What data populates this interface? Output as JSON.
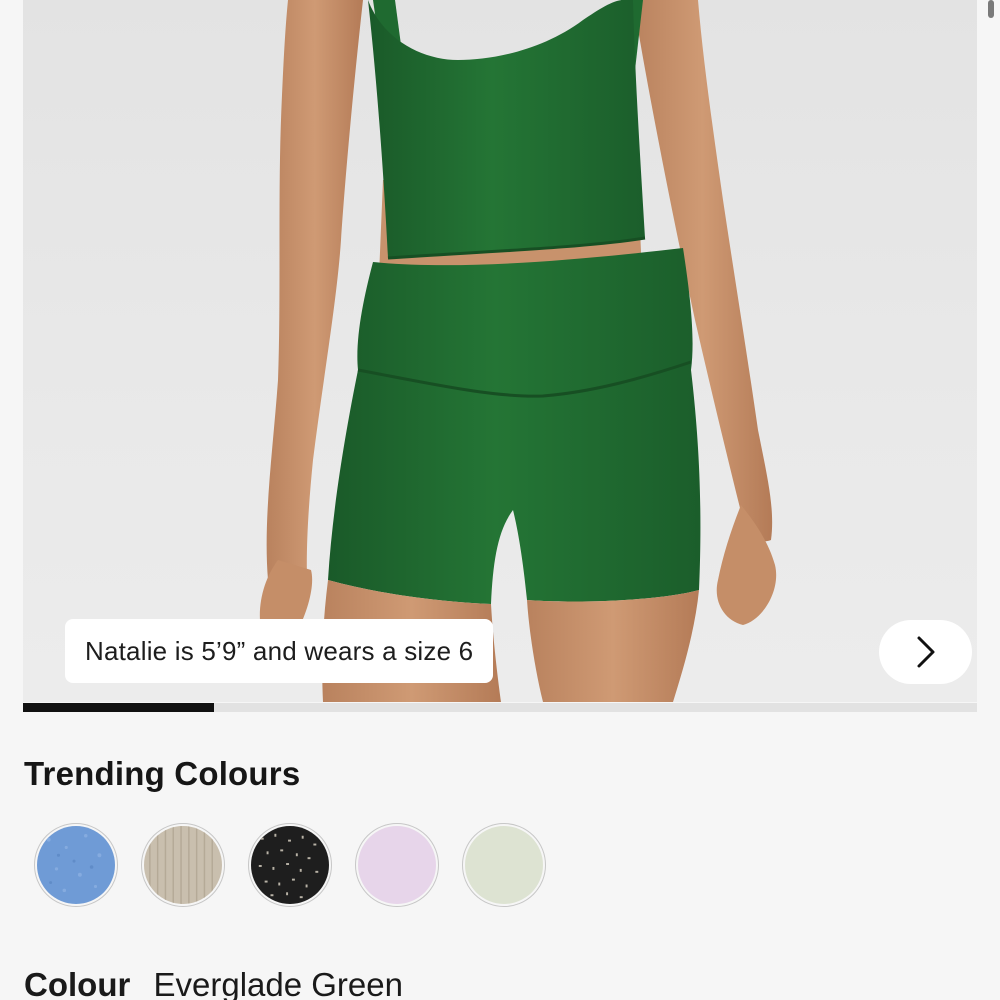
{
  "hero": {
    "caption": "Natalie is 5’9” and wears a size 6",
    "next_icon": "chevron-right-icon",
    "carousel_progress": 0.2
  },
  "trending": {
    "title": "Trending Colours",
    "swatches": [
      {
        "color": "#6f9bd6"
      },
      {
        "color": "#c9bfae"
      },
      {
        "color": "#1e1e1e"
      },
      {
        "color": "#e7d5ea"
      },
      {
        "color": "#dde3d2"
      }
    ]
  },
  "colour": {
    "label": "Colour",
    "value": "Everglade Green"
  },
  "colors": {
    "garment": "#1f6a30",
    "background": "#f6f6f6"
  }
}
